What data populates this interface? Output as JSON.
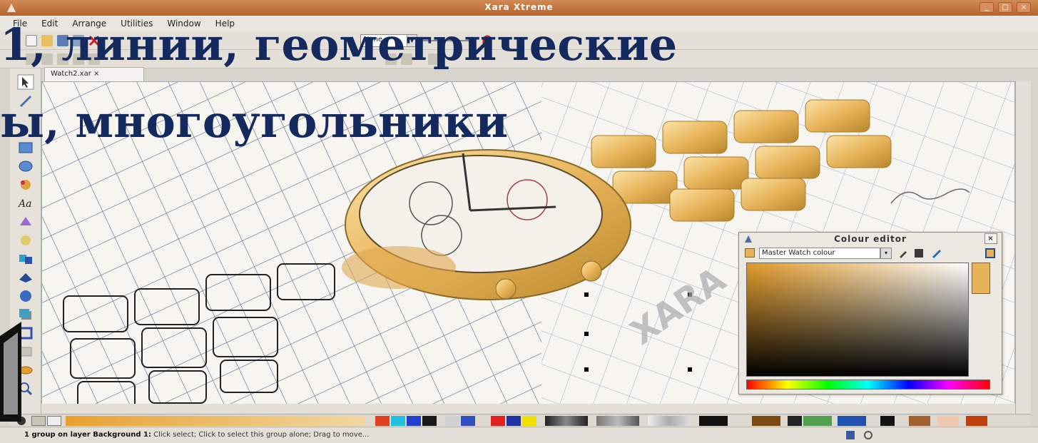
{
  "window": {
    "title": "Xara Xtreme",
    "buttons": [
      "_",
      "□",
      "×"
    ]
  },
  "menu": [
    "File",
    "Edit",
    "Arrange",
    "Utilities",
    "Window",
    "Help"
  ],
  "toolbar": {
    "line_style": "None"
  },
  "document_tab": "Watch2.xar ×",
  "heading": {
    "line1": "1, линии,   геометрические",
    "line2": "ы, многоугольники"
  },
  "canvas": {
    "watermark": "XARA"
  },
  "colour_editor": {
    "title": "Colour editor",
    "close": "×",
    "colour_name": "Master Watch colour",
    "dropdown": "▾"
  },
  "status": {
    "bold": "1 group on layer Background 1:",
    "text": " Click select; Click to select this group alone; Drag to move..."
  },
  "colors": {
    "heading": "#142a5e",
    "title_bar": "#c07438",
    "accent_gold": "#e8b45a"
  }
}
